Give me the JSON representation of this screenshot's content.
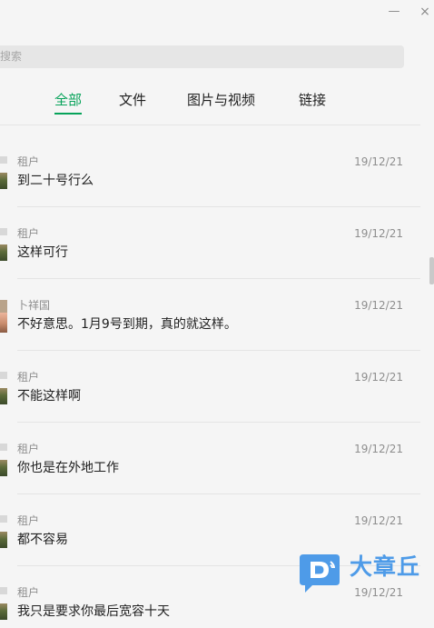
{
  "window": {
    "minimize_glyph": "—",
    "close_glyph": "×"
  },
  "search": {
    "placeholder": "搜索"
  },
  "tabs": [
    {
      "label": "全部",
      "active": true
    },
    {
      "label": "文件",
      "active": false
    },
    {
      "label": "图片与视频",
      "active": false
    },
    {
      "label": "链接",
      "active": false
    }
  ],
  "messages": [
    {
      "sender": "租户",
      "date": "19/12/21",
      "text": "到二十号行么",
      "avatar": "landscape"
    },
    {
      "sender": "租户",
      "date": "19/12/21",
      "text": "这样可行",
      "avatar": "landscape"
    },
    {
      "sender": "卜祥国",
      "date": "19/12/21",
      "text": "不好意思。1月9号到期，真的就这样。",
      "avatar": "person"
    },
    {
      "sender": "租户",
      "date": "19/12/21",
      "text": "不能这样啊",
      "avatar": "landscape"
    },
    {
      "sender": "租户",
      "date": "19/12/21",
      "text": "你也是在外地工作",
      "avatar": "landscape"
    },
    {
      "sender": "租户",
      "date": "19/12/21",
      "text": "都不容易",
      "avatar": "landscape"
    },
    {
      "sender": "租户",
      "date": "19/12/21",
      "text": "我只是要求你最后宽容十天",
      "avatar": "landscape"
    }
  ],
  "watermark": {
    "text": "大章丘",
    "logo_letter": "D"
  },
  "colors": {
    "accent": "#07a35a",
    "watermark": "#4e9be8"
  }
}
